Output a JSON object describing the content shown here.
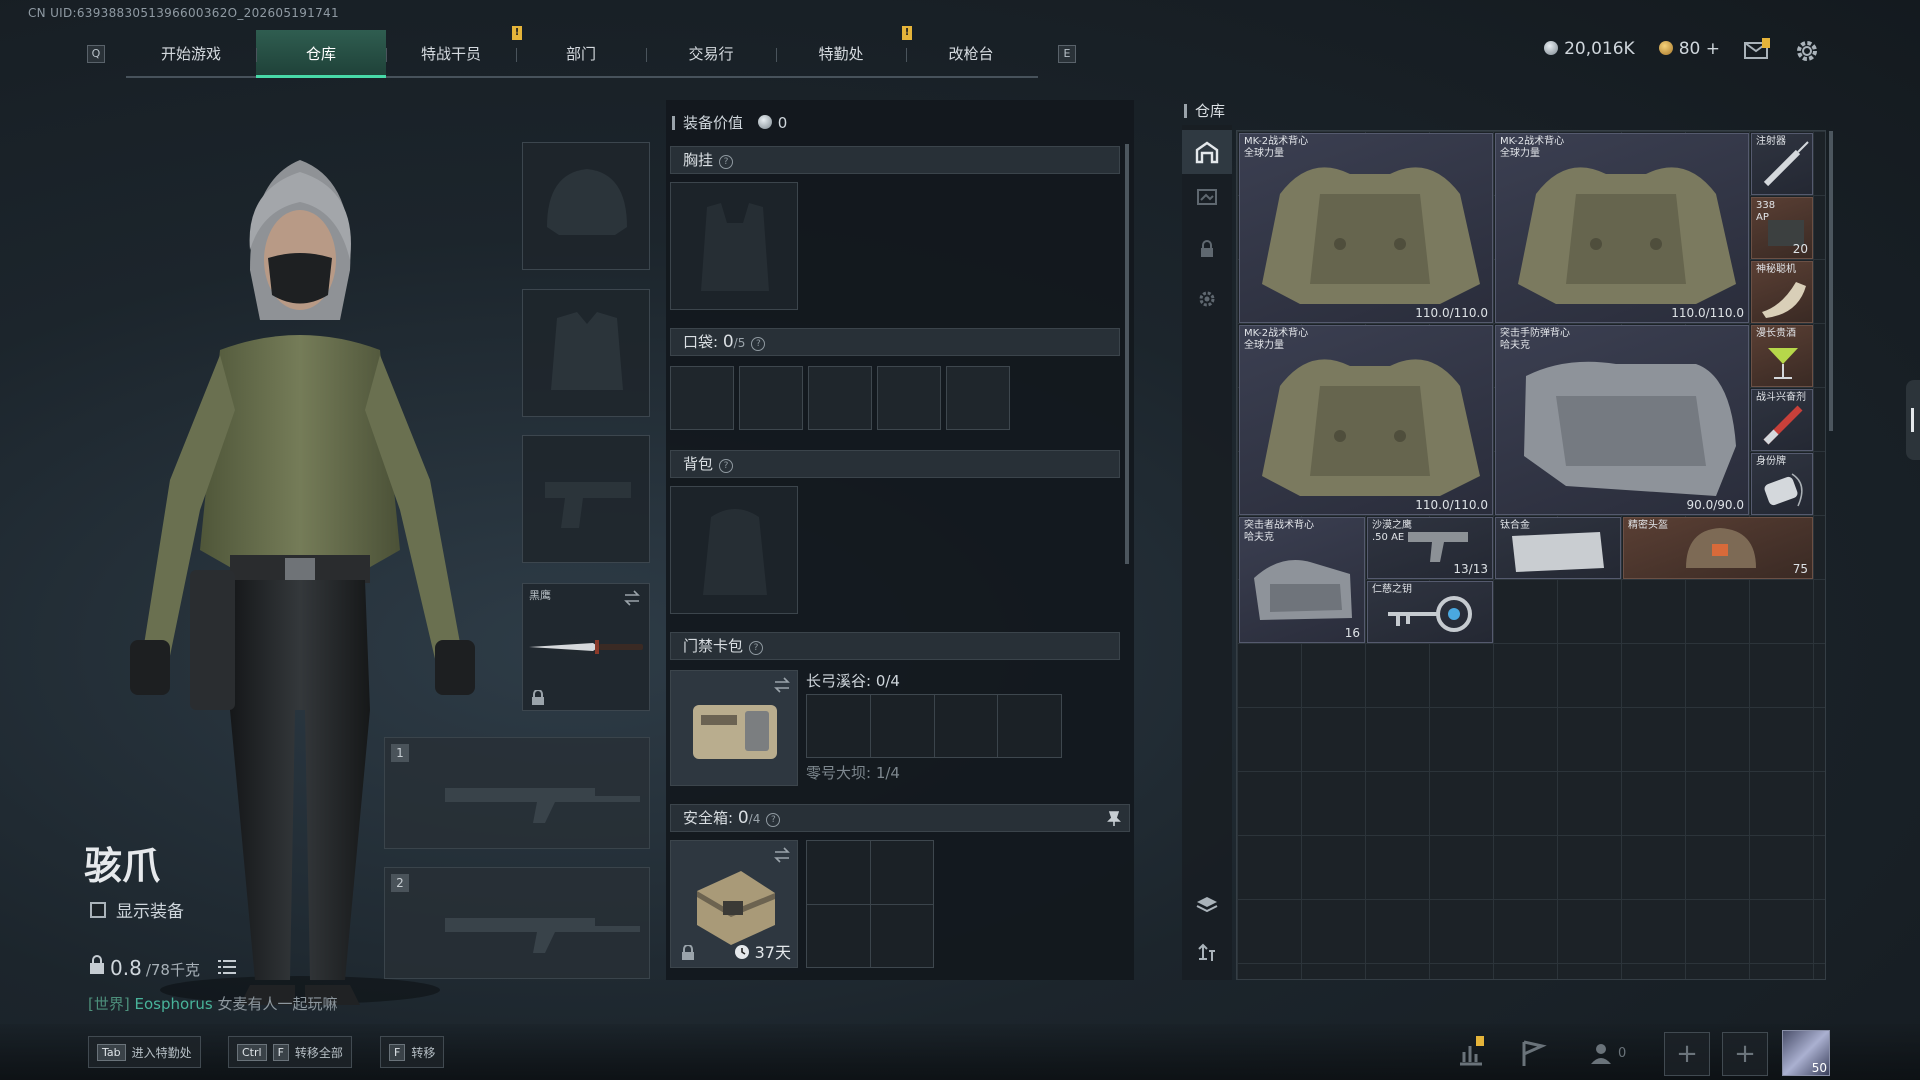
{
  "uid": "CN UID:6393883051396600362O_202605191741",
  "nav": {
    "left_key": "Q",
    "right_key": "E",
    "tabs": [
      {
        "label": "开始游戏",
        "active": false,
        "alert": false
      },
      {
        "label": "仓库",
        "active": true,
        "alert": false
      },
      {
        "label": "特战干员",
        "active": false,
        "alert": true
      },
      {
        "label": "部门",
        "active": false,
        "alert": false
      },
      {
        "label": "交易行",
        "active": false,
        "alert": false
      },
      {
        "label": "特勤处",
        "active": false,
        "alert": true
      },
      {
        "label": "改枪台",
        "active": false,
        "alert": false
      }
    ],
    "alert_glyph": "!"
  },
  "currency": {
    "silver": "20,016K",
    "gold": "80",
    "gold_add": "+"
  },
  "icons": {
    "mail": "mail-icon",
    "settings": "gear-icon"
  },
  "character": {
    "name": "骇爪",
    "show_equip_label": "显示装备",
    "weight_current": "0.8",
    "weight_max": "/78千克"
  },
  "chat": {
    "channel": "[世界]",
    "user": "Eosphorus",
    "message": "女麦有人一起玩嘛"
  },
  "gear": {
    "knife_label": "黑鹰",
    "weapon_slot_1": "1",
    "weapon_slot_2": "2"
  },
  "loadout": {
    "equip_value_label": "装备价值",
    "equip_value": "0",
    "chest_label": "胸挂",
    "pocket_label": "口袋:",
    "pocket_count": "0",
    "pocket_max": "/5",
    "backpack_label": "背包",
    "keycard_label": "门禁卡包",
    "keycard_area_1": "长弓溪谷: 0/4",
    "keycard_area_2": "零号大坝: 1/4",
    "safebox_label": "安全箱:",
    "safebox_count": "0",
    "safebox_max": "/4",
    "safebox_time": "37天",
    "qmark": "?"
  },
  "warehouse": {
    "title": "仓库",
    "items": [
      {
        "name": "MK-2战术背心\n全球力量",
        "value": "110.0/110.0"
      },
      {
        "name": "MK-2战术背心\n全球力量",
        "value": "110.0/110.0"
      },
      {
        "name": "MK-2战术背心\n全球力量",
        "value": "110.0/110.0"
      },
      {
        "name": "突击手防弹背心\n哈夫克",
        "value": "90.0/90.0"
      },
      {
        "name": "突击者战术背心\n哈夫克",
        "value": "16"
      },
      {
        "name": "沙漠之鹰\n.50 AE",
        "value": "13/13"
      },
      {
        "name": "钛合金",
        "value": ""
      },
      {
        "name": "精密头盔",
        "value": "75"
      },
      {
        "name": "仁慈之钥",
        "value": ""
      },
      {
        "name": "注射器",
        "value": ""
      },
      {
        "name": "338\nAP",
        "value": "20"
      },
      {
        "name": "神秘聪机",
        "value": ""
      },
      {
        "name": "漫长贵酒",
        "value": ""
      },
      {
        "name": "战斗兴奋剂",
        "value": ""
      },
      {
        "name": "身份牌",
        "value": ""
      }
    ]
  },
  "bottom": {
    "enter_key": "Tab",
    "enter_label": "进入特勤处",
    "transfer_all_keys": [
      "Ctrl",
      "F"
    ],
    "transfer_all_label": "转移全部",
    "transfer_key": "F",
    "transfer_label": "转移",
    "friends_count": "0",
    "plus": "+",
    "level": "50"
  },
  "colors": {
    "accent": "#48d9a8",
    "alert": "#e5b43a",
    "item_bg": "#343848"
  }
}
